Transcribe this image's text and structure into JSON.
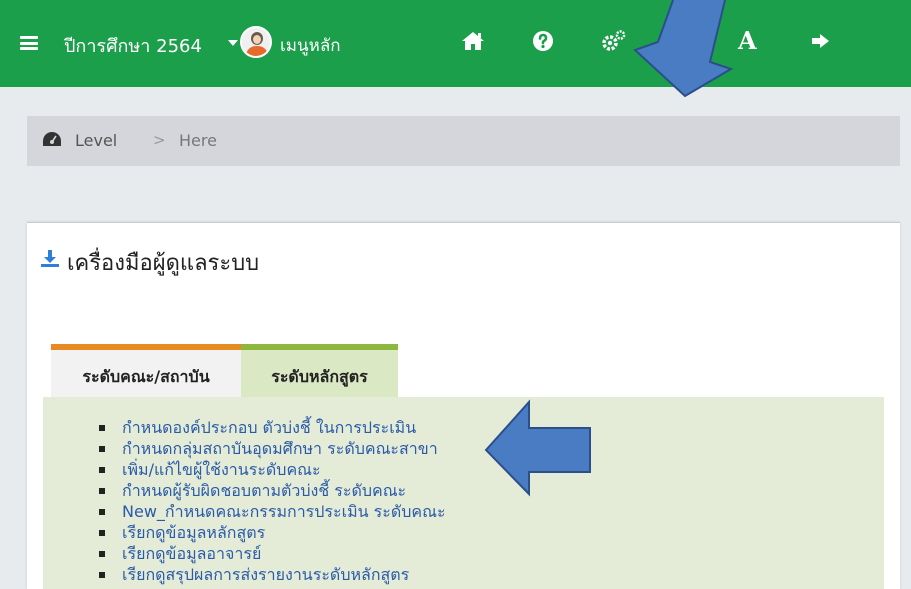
{
  "header": {
    "year_label": "ปีการศึกษา 2564",
    "username": "เมนูหลัก",
    "icons": [
      "menu-icon",
      "home-icon",
      "help-icon",
      "settings-icon",
      "font-size-icon",
      "logout-icon"
    ],
    "font_size_label": "A",
    "background_color": "#1c9f4a"
  },
  "breadcrumb": {
    "level": "Level",
    "separator": ">",
    "current": "Here"
  },
  "panel": {
    "title": "เครื่องมือผู้ดูแลระบบ",
    "tabs": [
      {
        "label": "ระดับคณะ/สถาบัน",
        "active": true,
        "color": "#e88a22"
      },
      {
        "label": "ระดับหลักสูตร",
        "active": false,
        "color": "#8db83d"
      }
    ],
    "links": [
      "กำหนดองค์ประกอบ ตัวบ่งชี้ ในการประเมิน",
      "กำหนดกลุ่มสถาบันอุดมศึกษา ระดับคณะสาขา",
      "เพิ่ม/แก้ไขผู้ใช้งานระดับคณะ",
      "กำหนดผู้รับผิดชอบตามตัวบ่งชี้ ระดับคณะ",
      "New_กำหนดคณะกรรมการประเมิน ระดับคณะ",
      "เรียกดูข้อมูลหลักสูตร",
      "เรียกดูข้อมูลอาจารย์",
      "เรียกดูสรุปผลการส่งรายงานระดับหลักสูตร"
    ]
  },
  "annotation_color": "#4a7cc4"
}
